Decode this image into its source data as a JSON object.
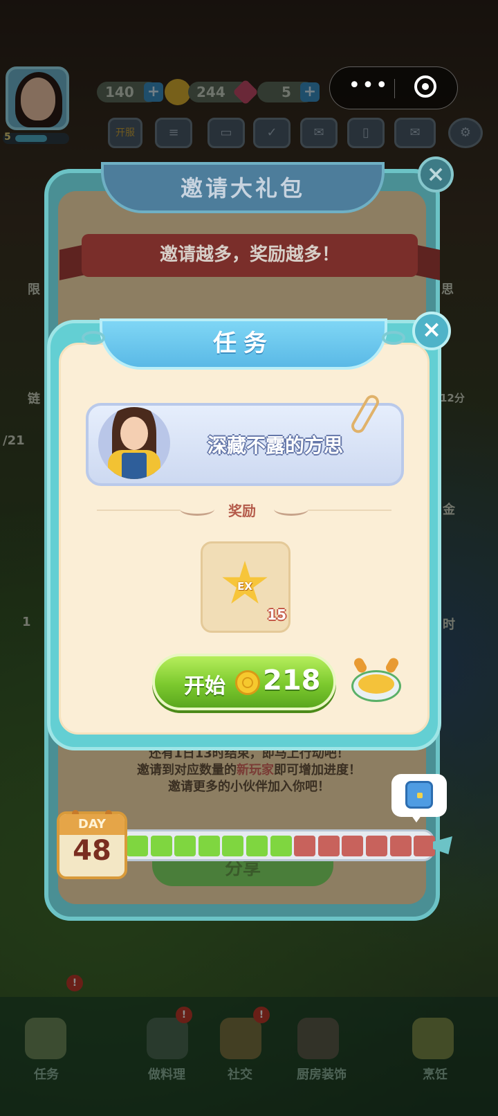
{
  "hud": {
    "level": "5",
    "energy": "140",
    "coins": "244",
    "gems": "5",
    "events_label": "开服"
  },
  "invite_panel": {
    "title": "邀请大礼包",
    "ribbon": "邀请越多，奖励越多！",
    "line1": "还有1日13时结束，即马上行动吧！",
    "line2_prefix": "邀请到对应数量的",
    "line2_highlight": "新玩家",
    "line2_suffix": "即可增加进度！",
    "line3": "邀请更多的小伙伴加入你吧！",
    "button": "分享"
  },
  "progress": {
    "day_label": "DAY",
    "day": "48",
    "filled_segments": 7,
    "total_segments": 13
  },
  "task_dialog": {
    "title": "任务",
    "close": "×",
    "task_name": "深藏不露的方思",
    "reward_label": "奖励",
    "reward_item": "EX",
    "reward_count": "15",
    "start_label": "开始",
    "start_cost": "218"
  },
  "side": {
    "left": [
      "限",
      "链",
      "/21",
      "1"
    ],
    "right": [
      "思",
      "12分",
      "金",
      "时"
    ]
  },
  "bottom_nav": [
    "任务",
    "做料理",
    "社交",
    "厨房装饰",
    "烹饪"
  ],
  "colors": {
    "green_segment": "#7fd640",
    "red_segment": "#c8625c",
    "accent_teal": "#63cfd3"
  }
}
